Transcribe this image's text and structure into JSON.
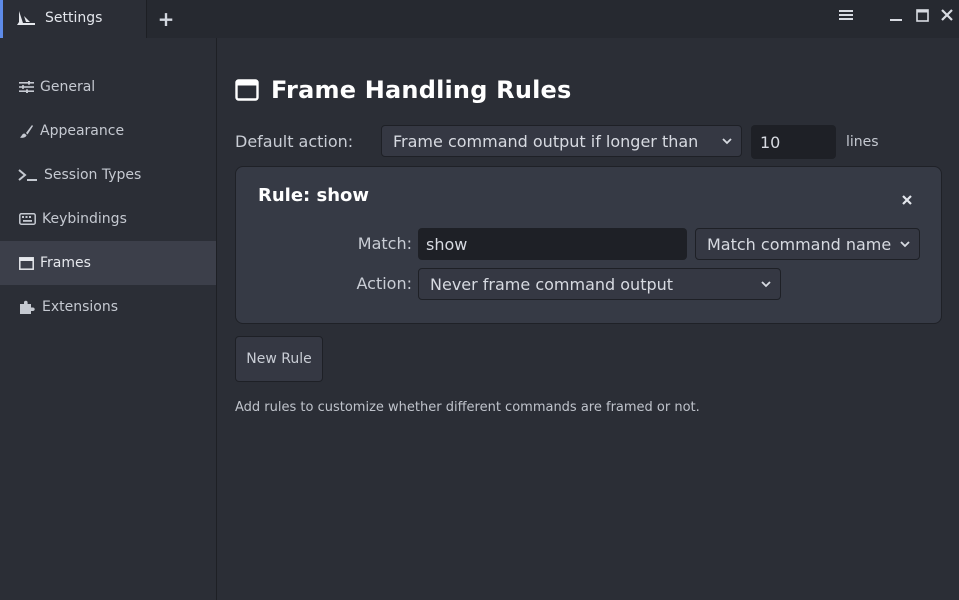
{
  "window": {
    "tab_label": "Settings",
    "new_tab_label": "+"
  },
  "sidebar": {
    "items": [
      {
        "label": "General",
        "icon": "sliders-icon"
      },
      {
        "label": "Appearance",
        "icon": "brush-icon"
      },
      {
        "label": "Session Types",
        "icon": "terminal-icon"
      },
      {
        "label": "Keybindings",
        "icon": "keyboard-icon"
      },
      {
        "label": "Frames",
        "icon": "frame-icon",
        "active": true
      },
      {
        "label": "Extensions",
        "icon": "puzzle-icon"
      }
    ]
  },
  "main": {
    "title": "Frame Handling Rules",
    "default_action": {
      "label": "Default action:",
      "selected": "Frame command output if longer than",
      "lines_value": "10",
      "lines_label": "lines"
    },
    "rule": {
      "title": "Rule: show",
      "match_label": "Match:",
      "match_value": "show",
      "match_type": "Match command name",
      "action_label": "Action:",
      "action_value": "Never frame command output"
    },
    "new_rule_label": "New Rule",
    "help_text": "Add rules to customize whether different commands are framed or not."
  },
  "colors": {
    "background": "#2b2e36",
    "titlebar": "#262930",
    "active_item": "#3c3f4a",
    "accent": "#5e8be8",
    "card": "#363a45",
    "input": "#1e2026"
  }
}
